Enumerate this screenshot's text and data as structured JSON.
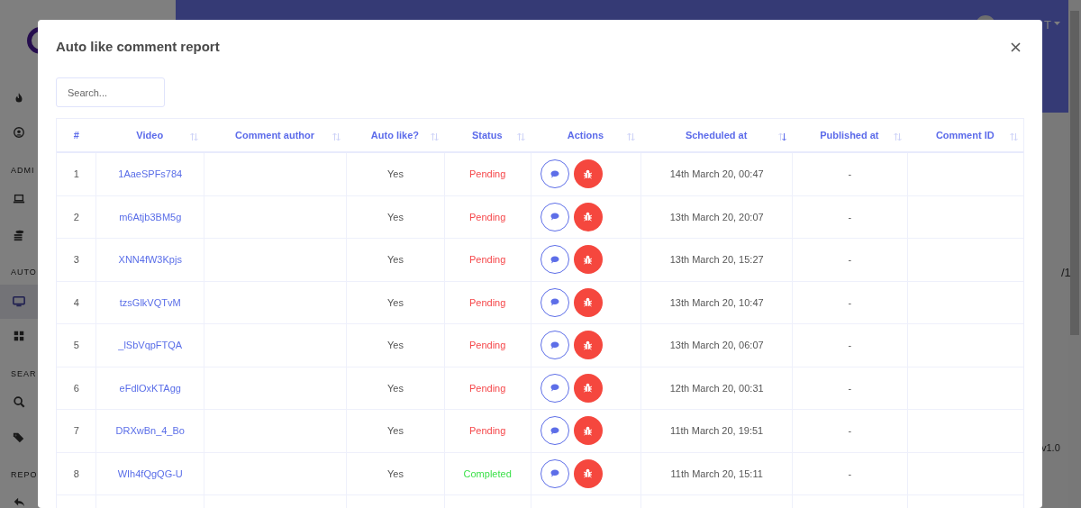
{
  "background": {
    "sidebar_sections": [
      "ADMI",
      "AUTO",
      "SEAR",
      "REPO"
    ],
    "sidebar_items": [
      {
        "selected": false
      },
      {
        "selected": false
      },
      {
        "selected": false
      },
      {
        "selected": false
      },
      {
        "selected": true
      },
      {
        "selected": false
      },
      {
        "selected": false
      },
      {
        "selected": false
      },
      {
        "selected": false
      }
    ],
    "user_menu": "T",
    "pager_text": "/1",
    "version": "v1.0"
  },
  "modal": {
    "title": "Auto like comment report",
    "search": {
      "placeholder": "Search..."
    },
    "table": {
      "columns": [
        {
          "label": "#",
          "kind": "plain"
        },
        {
          "label": "Video",
          "kind": "sortable"
        },
        {
          "label": "Comment author",
          "kind": "sortable"
        },
        {
          "label": "Auto like?",
          "kind": "sortable"
        },
        {
          "label": "Status",
          "kind": "sortable"
        },
        {
          "label": "Actions",
          "kind": "sortable"
        },
        {
          "label": "Scheduled at",
          "kind": "sorted_desc"
        },
        {
          "label": "Published at",
          "kind": "sortable"
        },
        {
          "label": "Comment ID",
          "kind": "sortable"
        }
      ],
      "rows": [
        {
          "index": "1",
          "video": "1AaeSPFs784",
          "auto_like": "Yes",
          "status": {
            "text": "Pending",
            "kind": "pending"
          },
          "scheduled_at": "14th March 20, 00:47",
          "published_at": "-"
        },
        {
          "index": "2",
          "video": "m6Atjb3BM5g",
          "auto_like": "Yes",
          "status": {
            "text": "Pending",
            "kind": "pending"
          },
          "scheduled_at": "13th March 20, 20:07",
          "published_at": "-"
        },
        {
          "index": "3",
          "video": "XNN4fW3Kpjs",
          "auto_like": "Yes",
          "status": {
            "text": "Pending",
            "kind": "pending"
          },
          "scheduled_at": "13th March 20, 15:27",
          "published_at": "-"
        },
        {
          "index": "4",
          "video": "tzsGlkVQTvM",
          "auto_like": "Yes",
          "status": {
            "text": "Pending",
            "kind": "pending"
          },
          "scheduled_at": "13th March 20, 10:47",
          "published_at": "-"
        },
        {
          "index": "5",
          "video": "_lSbVqpFTQA",
          "auto_like": "Yes",
          "status": {
            "text": "Pending",
            "kind": "pending"
          },
          "scheduled_at": "13th March 20, 06:07",
          "published_at": "-"
        },
        {
          "index": "6",
          "video": "eFdlOxKTAgg",
          "auto_like": "Yes",
          "status": {
            "text": "Pending",
            "kind": "pending"
          },
          "scheduled_at": "12th March 20, 00:31",
          "published_at": "-"
        },
        {
          "index": "7",
          "video": "DRXwBn_4_Bo",
          "auto_like": "Yes",
          "status": {
            "text": "Pending",
            "kind": "pending"
          },
          "scheduled_at": "11th March 20, 19:51",
          "published_at": "-"
        },
        {
          "index": "8",
          "video": "WIh4fQgQG-U",
          "auto_like": "Yes",
          "status": {
            "text": "Completed",
            "kind": "completed"
          },
          "scheduled_at": "11th March 20, 15:11",
          "published_at": "-"
        }
      ]
    }
  }
}
